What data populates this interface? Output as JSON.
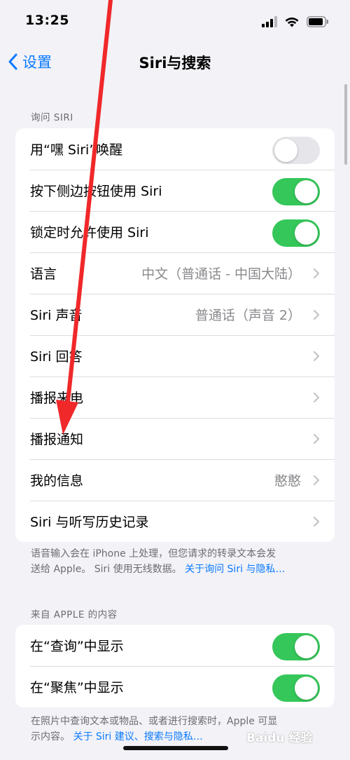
{
  "status_bar": {
    "time": "13:25"
  },
  "nav": {
    "back_label": "设置",
    "title": "Siri与搜索"
  },
  "ask_siri": {
    "header": "询问 SIRI",
    "rows": [
      {
        "label": "用“嘿 Siri”唤醒",
        "toggle": false
      },
      {
        "label": "按下侧边按钮使用 Siri",
        "toggle": true
      },
      {
        "label": "锁定时允许使用 Siri",
        "toggle": true
      },
      {
        "label": "语言",
        "value": "中文（普通话 - 中国大陆）"
      },
      {
        "label": "Siri 声音",
        "value": "普通话（声音 2）"
      },
      {
        "label": "Siri 回答",
        "value": ""
      },
      {
        "label": "播报来电",
        "value": ""
      },
      {
        "label": "播报通知",
        "value": ""
      },
      {
        "label": "我的信息",
        "value": "憨憨"
      },
      {
        "label": "Siri 与听写历史记录",
        "value": ""
      }
    ],
    "footer_line1": "语音输入会在 iPhone 上处理，但您请求的转录文本会发",
    "footer_line2": "送给 Apple。 Siri 使用无线数据。",
    "footer_link": "关于询问 Siri 与隐私…"
  },
  "from_apple": {
    "header": "来自 APPLE 的内容",
    "rows": [
      {
        "label": "在“查询”中显示",
        "toggle": true
      },
      {
        "label": "在“聚焦”中显示",
        "toggle": true
      }
    ],
    "footer_line1": "在照片中查询文本或物品、或者进行搜索时，Apple 可显",
    "footer_line2": "示内容。",
    "footer_link": "关于 Siri 建议、搜索与隐私…"
  },
  "watermark": "Baidu 经验",
  "colors": {
    "accent": "#0a7aff",
    "toggle_on": "#35c759",
    "annotation_arrow": "#f0282a"
  }
}
